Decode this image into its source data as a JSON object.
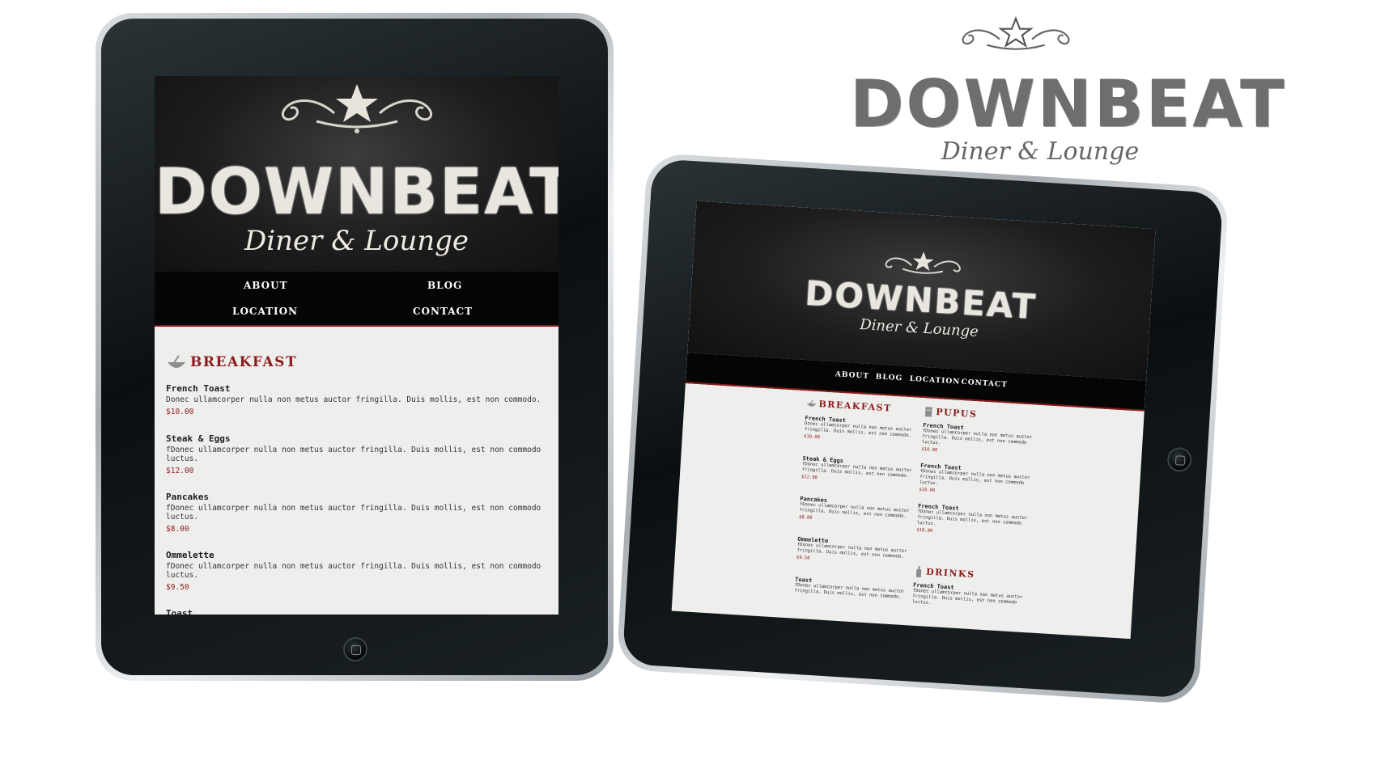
{
  "brand": {
    "name": "DOWNBEAT",
    "tagline": "Diner & Lounge"
  },
  "nav": {
    "about": "ABOUT",
    "blog": "BLOG",
    "location": "LOCATION",
    "contact": "CONTACT"
  },
  "portrait": {
    "section_title": "BREAKFAST",
    "items": [
      {
        "name": "French Toast",
        "desc": "Donec ullamcorper nulla non metus auctor fringilla. Duis mollis, est non commodo.",
        "price": "$10.00"
      },
      {
        "name": "Steak & Eggs",
        "desc": "fDonec ullamcorper nulla non metus auctor fringilla. Duis mollis, est non commodo luctus.",
        "price": "$12.00"
      },
      {
        "name": "Pancakes",
        "desc": "fDonec ullamcorper nulla non metus auctor fringilla. Duis mollis, est non commodo luctus.",
        "price": "$8.00"
      },
      {
        "name": "Ommelette",
        "desc": "fDonec ullamcorper nulla non metus auctor fringilla. Duis mollis, est non commodo luctus.",
        "price": "$9.50"
      },
      {
        "name": "Toast",
        "desc": "",
        "price": ""
      }
    ]
  },
  "landscape": {
    "breakfast_title": "BREAKFAST",
    "breakfast_items": [
      {
        "name": "French Toast",
        "desc": "Donec ullamcorper nulla non metus auctor fringilla. Duis mollis, est non commodo.",
        "price": "$10.00"
      },
      {
        "name": "Steak & Eggs",
        "desc": "fDonec ullamcorper nulla non metus auctor fringilla. Duis mollis, est non commodo.",
        "price": "$12.00"
      },
      {
        "name": "Pancakes",
        "desc": "fDonec ullamcorper nulla non metus auctor fringilla. Duis mollis, est non commodo.",
        "price": "$8.00"
      },
      {
        "name": "Ommelette",
        "desc": "fDonec ullamcorper nulla non metus auctor fringilla. Duis mollis, est non commodo.",
        "price": "$9.50"
      },
      {
        "name": "Toast",
        "desc": "fDonec ullamcorper nulla non metus auctor fringilla. Duis mollis, est non commodo.",
        "price": ""
      }
    ],
    "pupus_title": "PUPUS",
    "pupus_items": [
      {
        "name": "French Toast",
        "desc": "fDonec ullamcorper nulla non metus auctor fringilla. Duis mollis, est non commodo luctus.",
        "price": "$10.00"
      },
      {
        "name": "French Toast",
        "desc": "fDonec ullamcorper nulla non metus auctor fringilla. Duis mollis, est non commodo luctus.",
        "price": "$10.00"
      },
      {
        "name": "French Toast",
        "desc": "fDonec ullamcorper nulla non metus auctor fringilla. Duis mollis, est non commodo luctus.",
        "price": "$10.00"
      }
    ],
    "drinks_title": "DRINKS",
    "drinks_items": [
      {
        "name": "French Toast",
        "desc": "fDonec ullamcorper nulla non metus auctor fringilla. Duis mollis, est non commodo luctus.",
        "price": ""
      }
    ]
  },
  "colors": {
    "accent_red": "#8b1c1c",
    "nav_bg": "#050505",
    "header_bg": "#1d1d1d",
    "content_bg": "#eeeeec"
  }
}
